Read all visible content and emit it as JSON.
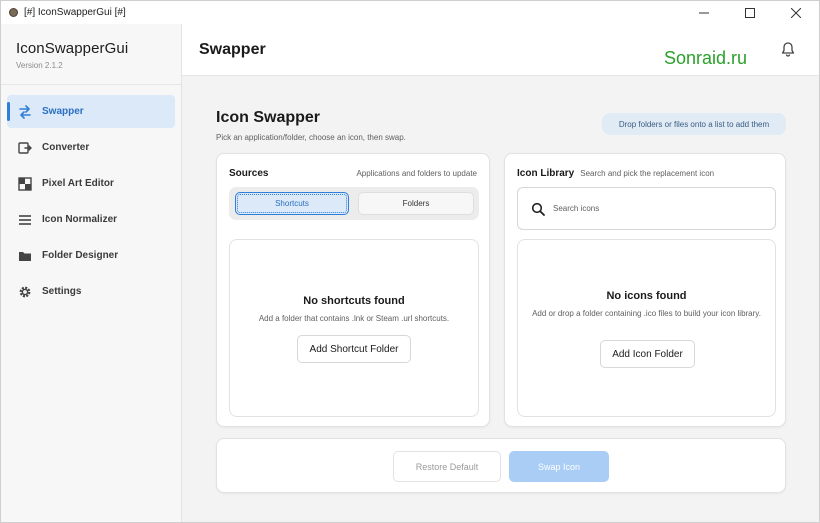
{
  "window": {
    "title": "[#] IconSwapperGui [#]",
    "controls": {
      "minimize": "—",
      "maximize": "☐",
      "close": "✕"
    }
  },
  "sidebar": {
    "app_name": "IconSwapperGui",
    "version": "Version 2.1.2",
    "items": [
      {
        "label": "Swapper",
        "icon": "swap-arrows-icon",
        "active": true
      },
      {
        "label": "Converter",
        "icon": "converter-icon",
        "active": false
      },
      {
        "label": "Pixel Art Editor",
        "icon": "pixel-grid-icon",
        "active": false
      },
      {
        "label": "Icon Normalizer",
        "icon": "list-lines-icon",
        "active": false
      },
      {
        "label": "Folder Designer",
        "icon": "folder-icon",
        "active": false
      },
      {
        "label": "Settings",
        "icon": "gear-icon",
        "active": false
      }
    ]
  },
  "header": {
    "title": "Swapper",
    "watermark": "Sonraid.ru",
    "bell_icon": "bell-icon"
  },
  "main": {
    "title": "Icon Swapper",
    "subtitle": "Pick an application/folder, choose an icon, then swap.",
    "hint": "Drop folders or files onto a list to add them",
    "sources": {
      "title": "Sources",
      "hint": "Applications and folders to update",
      "tabs": [
        {
          "label": "Shortcuts",
          "active": true
        },
        {
          "label": "Folders",
          "active": false
        }
      ],
      "empty_title": "No shortcuts found",
      "empty_desc": "Add a folder that contains .lnk or Steam .url shortcuts.",
      "button": "Add Shortcut Folder"
    },
    "library": {
      "title": "Icon Library",
      "hint": "Search and pick the replacement icon",
      "search_placeholder": "Search icons",
      "search_value": "",
      "empty_title": "No icons found",
      "empty_desc": "Add or drop a folder containing .ico files to build your icon library.",
      "button": "Add Icon Folder"
    },
    "actions": {
      "restore": "Restore Default",
      "swap": "Swap Icon"
    }
  },
  "colors": {
    "accent": "#2f7fd8",
    "active_bg": "#dce9f8",
    "watermark": "#2aa12a",
    "swap_disabled": "#a9cdf5"
  }
}
